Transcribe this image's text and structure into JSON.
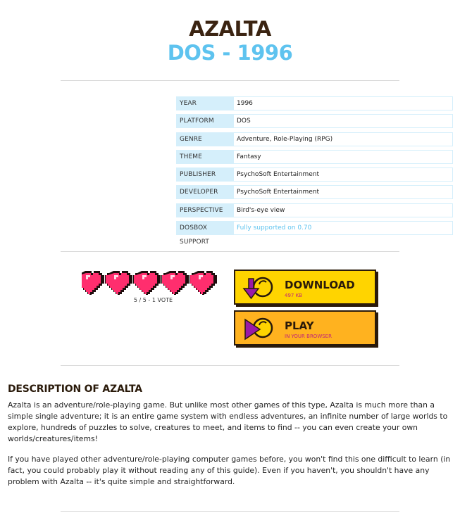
{
  "game": {
    "title": "AZALTA",
    "subtitle": "DOS - 1996"
  },
  "info": [
    {
      "label": "YEAR",
      "value": "1996",
      "link": false
    },
    {
      "label": "PLATFORM",
      "value": "DOS",
      "link": false
    },
    {
      "label": "GENRE",
      "value": "Adventure, Role-Playing (RPG)",
      "link": false
    },
    {
      "label": "THEME",
      "value": "Fantasy",
      "link": false
    },
    {
      "label": "PUBLISHER",
      "value": "PsychoSoft Entertainment",
      "link": false
    },
    {
      "label": "DEVELOPER",
      "value": "PsychoSoft Entertainment",
      "link": false
    },
    {
      "label": "PERSPECTIVE",
      "value": "Bird's-eye view",
      "link": false
    },
    {
      "label": "DOSBOX SUPPORT",
      "value": "Fully supported on 0.70",
      "link": true
    }
  ],
  "rating": {
    "stars": 5,
    "max": 5,
    "text": "5 / 5 - 1 VOTE"
  },
  "buttons": {
    "download_label": "DOWNLOAD",
    "download_sub": "497 KB",
    "play_label": "PLAY",
    "play_sub": "IN YOUR BROWSER"
  },
  "description": {
    "heading": "DESCRIPTION OF AZALTA",
    "paragraphs": [
      "Azalta is an adventure/role-playing game. But unlike most other games of this type, Azalta is much more than a simple single adventure; it is an entire game system with endless adventures, an infinite number of large worlds to explore, hundreds of puzzles to solve, creatures to meet, and items to find -- you can even create your own worlds/creatures/items!",
      "If you have played other adventure/role-playing computer games before, you won't find this one difficult to learn (in fact, you could probably play it without reading any of this guide). Even if you haven't, you shouldn't have any problem with Azalta -- it's quite simple and straightforward."
    ]
  },
  "colors": {
    "heart": "#ff2e6e",
    "accent": "#5ec3ef",
    "download_bg": "#ffd400",
    "play_bg": "#ffb21f",
    "icon_purple": "#9a1aa8"
  },
  "icons": {
    "download": "download-arrow-icon",
    "play": "play-triangle-icon",
    "rating": "heart-icon"
  }
}
